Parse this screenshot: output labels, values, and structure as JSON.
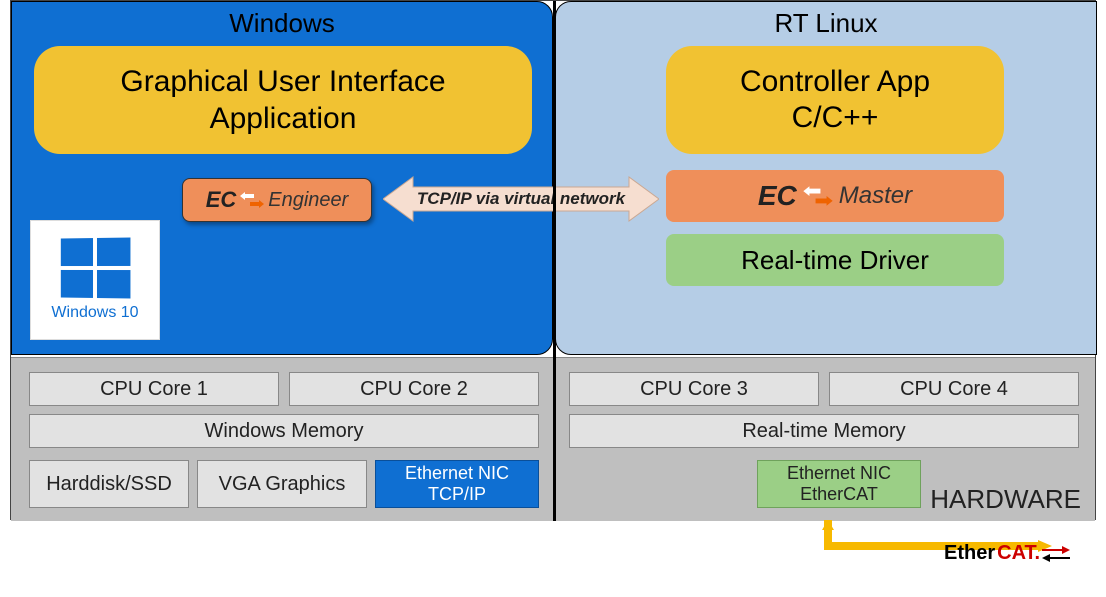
{
  "windows": {
    "title": "Windows",
    "gui_line1": "Graphical User Interface",
    "gui_line2": "Application",
    "ec_engineer_prefix": "EC",
    "ec_engineer_suffix": "Engineer",
    "logo_text": "Windows 10"
  },
  "linux": {
    "title": "RT Linux",
    "controller_line1": "Controller App",
    "controller_line2": "C/C++",
    "ec_master_prefix": "EC",
    "ec_master_suffix": "Master",
    "rt_driver": "Real-time Driver"
  },
  "connection": {
    "label": "TCP/IP via virtual network"
  },
  "hardware": {
    "label": "HARDWARE",
    "left": {
      "cpu1": "CPU Core 1",
      "cpu2": "CPU Core 2",
      "memory": "Windows Memory",
      "disk": "Harddisk/SSD",
      "vga": "VGA Graphics",
      "nic_line1": "Ethernet NIC",
      "nic_line2": "TCP/IP"
    },
    "right": {
      "cpu3": "CPU Core 3",
      "cpu4": "CPU Core 4",
      "memory": "Real-time Memory",
      "nic_line1": "Ethernet NIC",
      "nic_line2": "EtherCAT"
    }
  },
  "ethercat": {
    "ether": "Ether",
    "cat": "CAT."
  },
  "colors": {
    "windows_blue": "#0f6fd2",
    "linux_blue": "#b5cde6",
    "yellow": "#f1c232",
    "orange": "#ef8f5a",
    "green": "#9bcf86",
    "hw_gray": "#bfbfbf",
    "box_gray": "#e2e2e2"
  }
}
